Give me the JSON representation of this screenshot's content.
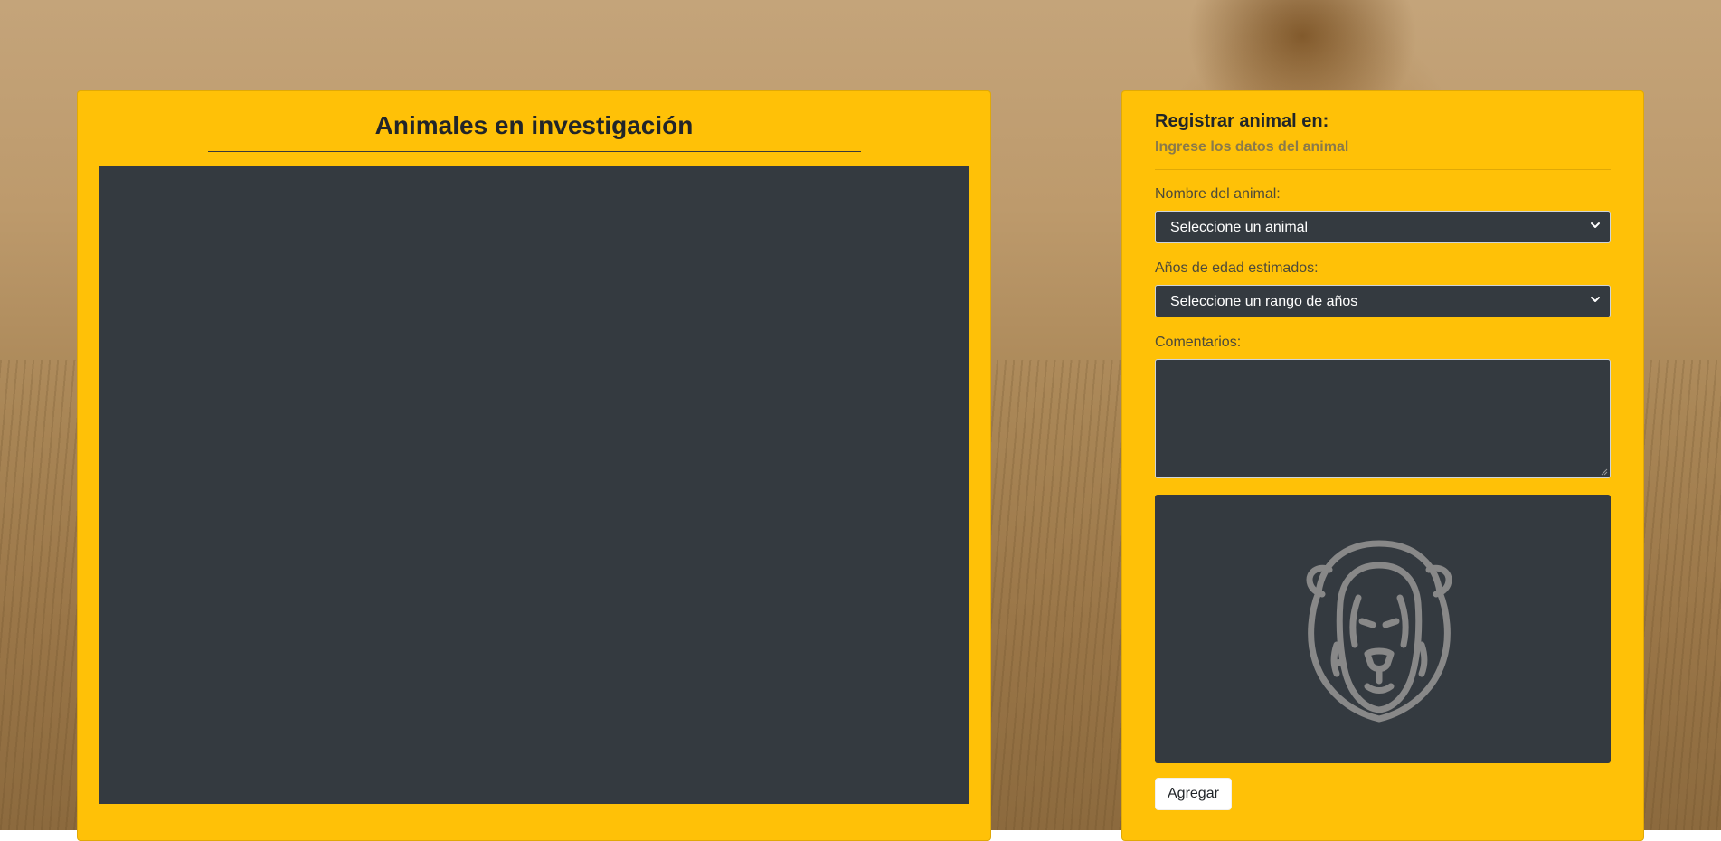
{
  "colors": {
    "card": "#ffc107",
    "dark": "#343a40",
    "icon": "#888888"
  },
  "left_panel": {
    "title": "Animales en investigación"
  },
  "form": {
    "title": "Registrar animal en:",
    "subtitle": "Ingrese los datos del animal",
    "animal_label": "Nombre del animal:",
    "animal_select_value": "Seleccione un animal",
    "age_label": "Años de edad estimados:",
    "age_select_value": "Seleccione un rango de años",
    "comments_label": "Comentarios:",
    "preview_icon": "lion-icon",
    "submit_label": "Agregar"
  }
}
